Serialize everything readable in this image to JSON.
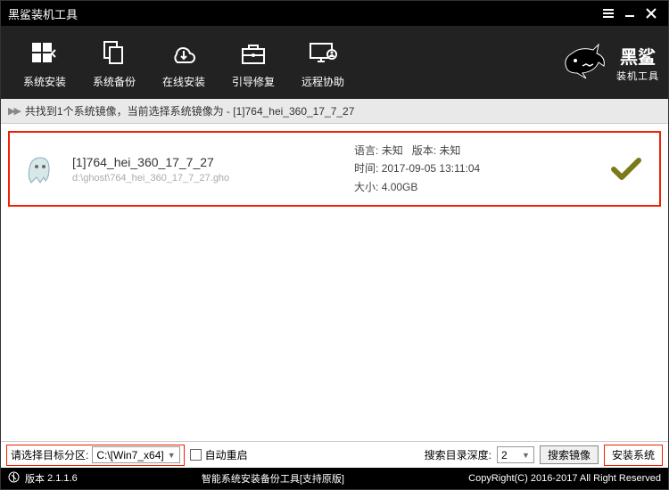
{
  "window": {
    "title": "黑鲨装机工具"
  },
  "toolbar": {
    "install": "系统安装",
    "backup": "系统备份",
    "online": "在线安装",
    "bootfix": "引导修复",
    "remote": "远程协助"
  },
  "brand": {
    "name": "黑鲨",
    "sub": "装机工具"
  },
  "infobar": {
    "text": "共找到1个系统镜像，当前选择系统镜像为 - [1]764_hei_360_17_7_27"
  },
  "image_item": {
    "name": "[1]764_hei_360_17_7_27",
    "path": "d:\\ghost\\764_hei_360_17_7_27.gho",
    "lang_label": "语言:",
    "lang_value": "未知",
    "ver_label": "版本:",
    "ver_value": "未知",
    "time_label": "时间:",
    "time_value": "2017-09-05 13:11:04",
    "size_label": "大小:",
    "size_value": "4.00GB"
  },
  "bottom": {
    "target_label": "请选择目标分区:",
    "target_value": "C:\\[Win7_x64]",
    "auto_restart": "自动重启",
    "depth_label": "搜索目录深度:",
    "depth_value": "2",
    "search_btn": "搜索镜像",
    "install_btn": "安装系统"
  },
  "status": {
    "version_label": "版本",
    "version": "2.1.1.6",
    "center": "智能系统安装备份工具[支持原版]",
    "copyright": "CopyRight(C) 2016-2017 All Right Reserved"
  }
}
